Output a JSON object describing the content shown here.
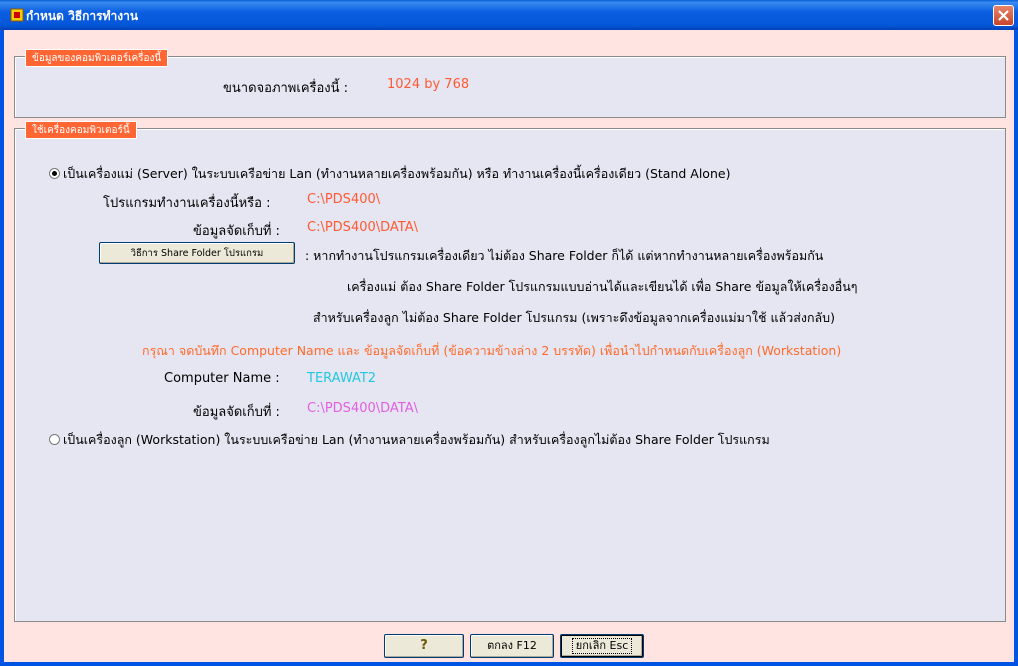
{
  "window": {
    "title": "กำหนด วิธีการทำงาน"
  },
  "computer_info": {
    "legend": "ข้อมูลของคอมพิวเตอร์เครื่องนี้",
    "resolution_label": "ขนาดจอภาพเครื่องนี้ :",
    "resolution_value": "1024 by 768"
  },
  "usage": {
    "legend": "ใช้เครื่องคอมพิวเตอร์นี้",
    "server_option_label": "เป็นเครื่องแม่ (Server) ในระบบเครือข่าย Lan (ทำงานหลายเครื่องพร้อมกัน) หรือ ทำงานเครื่องนี้เครื่องเดียว (Stand Alone)",
    "program_label": "โปรแกรมทำงานเครื่องนี้หรือ :",
    "program_path": "C:\\PDS400\\",
    "data_label": "ข้อมูลจัดเก็บที่ :",
    "data_path": "C:\\PDS400\\DATA\\",
    "share_button_label": "วิธีการ Share Folder โปรแกรม",
    "share_line1": ": หากทำงานโปรแกรมเครื่องเดียว ไม่ต้อง Share Folder ก็ได้ แต่หากทำงานหลายเครื่องพร้อมกัน",
    "share_line2": "เครื่องแม่ ต้อง Share Folder โปรแกรมแบบอ่านได้และเขียนได้  เพื่อ Share ข้อมูลให้เครื่องอื่นๆ",
    "share_line3": "สำหรับเครื่องลูก ไม่ต้อง Share Folder โปรแกรม (เพราะดึงข้อมูลจากเครื่องแม่มาใช้ แล้วส่งกลับ)",
    "note": "กรุณา จดบันทึก Computer Name และ ข้อมูลจัดเก็บที่ (ข้อความข้างล่าง 2 บรรทัด) เพื่อนำไปกำหนดกับเครื่องลูก (Workstation)",
    "computer_name_label": "Computer Name :",
    "computer_name_value": "TERAWAT2",
    "data_label2": "ข้อมูลจัดเก็บที่ :",
    "data_path2": "C:\\PDS400\\DATA\\",
    "workstation_option_label": "เป็นเครื่องลูก (Workstation) ในระบบเครือข่าย Lan (ทำงานหลายเครื่องพร้อมกัน) สำหรับเครื่องลูกไม่ต้อง Share Folder โปรแกรม",
    "selected_option": "server"
  },
  "footer": {
    "help_label": "?",
    "ok_label": "ตกลง F12",
    "cancel_label": "ยกเลิก Esc"
  },
  "colors": {
    "background": "#ffe4e1",
    "panel": "#e6e6f2",
    "legend": "#ff6633",
    "path_red": "#ff5a33",
    "cyan": "#22c8e0",
    "magenta": "#e060e0"
  }
}
